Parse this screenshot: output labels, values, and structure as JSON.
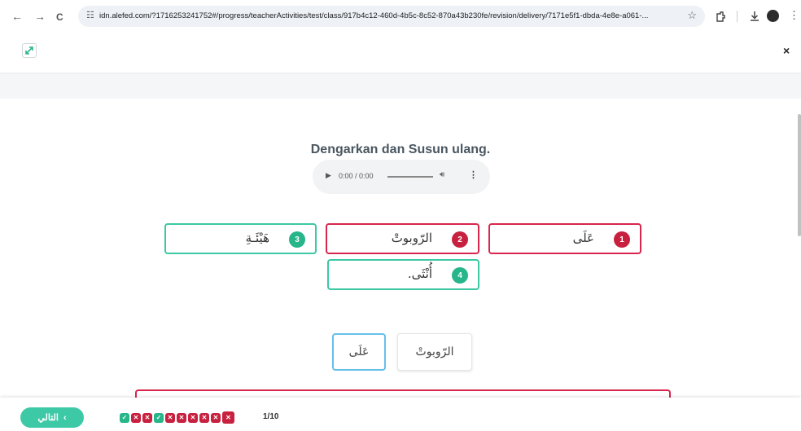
{
  "browser": {
    "back": "←",
    "forward": "→",
    "reload": "C",
    "url": "idn.alefed.com/?1716253241752#/progress/teacherActivities/test/class/917b4c12-460d-4b5c-8c52-870a43b230fe/revision/delivery/7171e5f1-dbda-4e8e-a061-...",
    "star": "☆"
  },
  "header": {
    "close": "×"
  },
  "question": {
    "title": "Dengarkan dan Susun ulang.",
    "audio": {
      "play": "▶",
      "time": "0:00 / 0:00",
      "volume": "🔊︎",
      "more": "⋮"
    }
  },
  "answers": [
    {
      "text": "هَيْئَـةِ",
      "badge": "3",
      "status": "correct"
    },
    {
      "text": "الرّوبوتْ",
      "badge": "2",
      "status": "wrong"
    },
    {
      "text": "عَلَى",
      "badge": "1",
      "status": "wrong"
    },
    {
      "text": "أُنْثَى.",
      "badge": "4",
      "status": "correct"
    }
  ],
  "choices": [
    {
      "text": "عَلَى",
      "selected": true
    },
    {
      "text": "الرّوبوتْ",
      "selected": false
    }
  ],
  "footer": {
    "next_label": "التالي",
    "next_arrow": "‹",
    "progress": [
      "correct",
      "wrong",
      "wrong",
      "correct",
      "wrong",
      "wrong",
      "wrong",
      "wrong",
      "wrong",
      "wrong"
    ],
    "progress_count": "1/10"
  },
  "colors": {
    "correct": "#27b58a",
    "wrong": "#c8213f",
    "selected_border": "#65c0ea",
    "next_button": "#3ec9a6"
  }
}
